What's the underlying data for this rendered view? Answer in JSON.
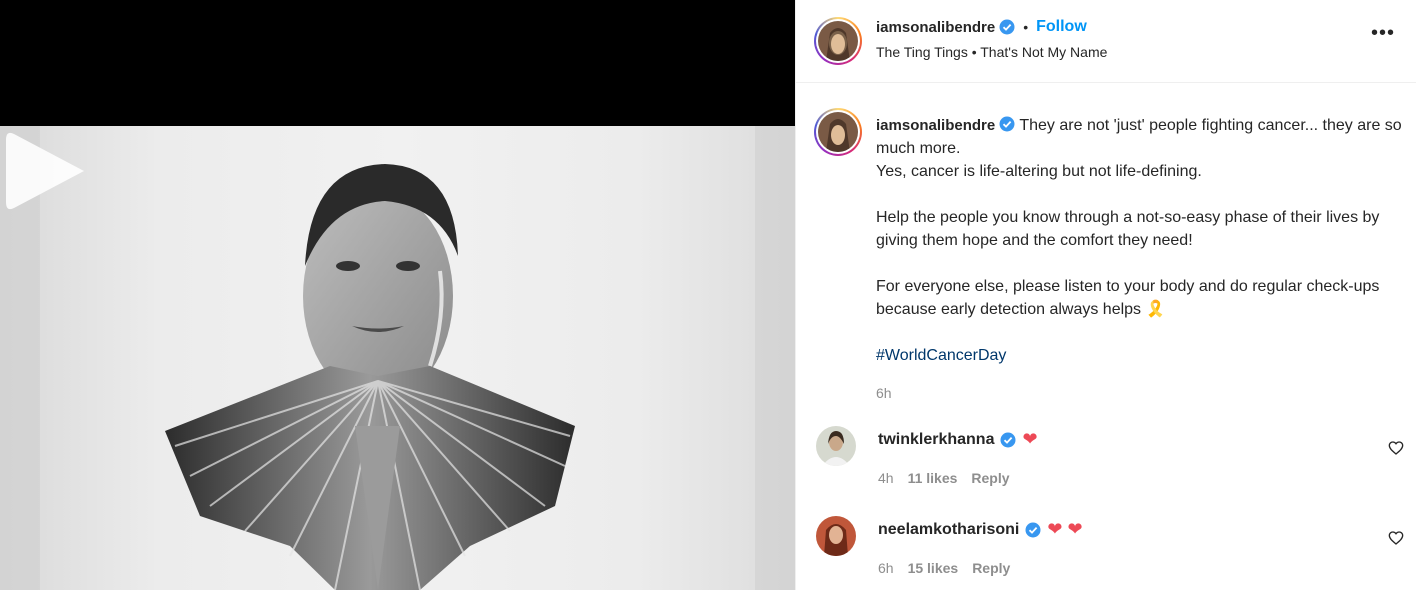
{
  "post": {
    "author": "iamsonalibendre",
    "follow_label": "Follow",
    "separator": "•",
    "audio": "The Ting Tings • That's Not My Name",
    "more_label": "•••"
  },
  "caption": {
    "author": "iamsonalibendre",
    "line1": "They are not 'just' people fighting cancer... they are so much more.",
    "line2": "Yes, cancer is life-altering but not life-defining.",
    "para2": "Help the people you know through a not-so-easy phase of their lives by giving them hope and the comfort they need!",
    "para3": "For everyone else, please listen to your body and do regular check-ups because early detection always helps",
    "para3_emoji": "🎗️",
    "hashtag": "#WorldCancerDay",
    "time": "6h"
  },
  "comments": [
    {
      "user": "twinklerkhanna",
      "text": "❤",
      "time": "4h",
      "likes": "11 likes",
      "reply": "Reply"
    },
    {
      "user": "neelamkotharisoni",
      "text": "❤ ❤",
      "time": "6h",
      "likes": "15 likes",
      "reply": "Reply"
    }
  ],
  "icons": {
    "verified": "verified-badge-icon",
    "play": "play-icon",
    "heart": "heart-outline-icon",
    "more": "more-options-icon"
  },
  "colors": {
    "accent": "#0095f6",
    "hashtag": "#00376b",
    "heart": "#ed4956",
    "verified": "#3897f0",
    "muted": "#8e8e8e"
  }
}
